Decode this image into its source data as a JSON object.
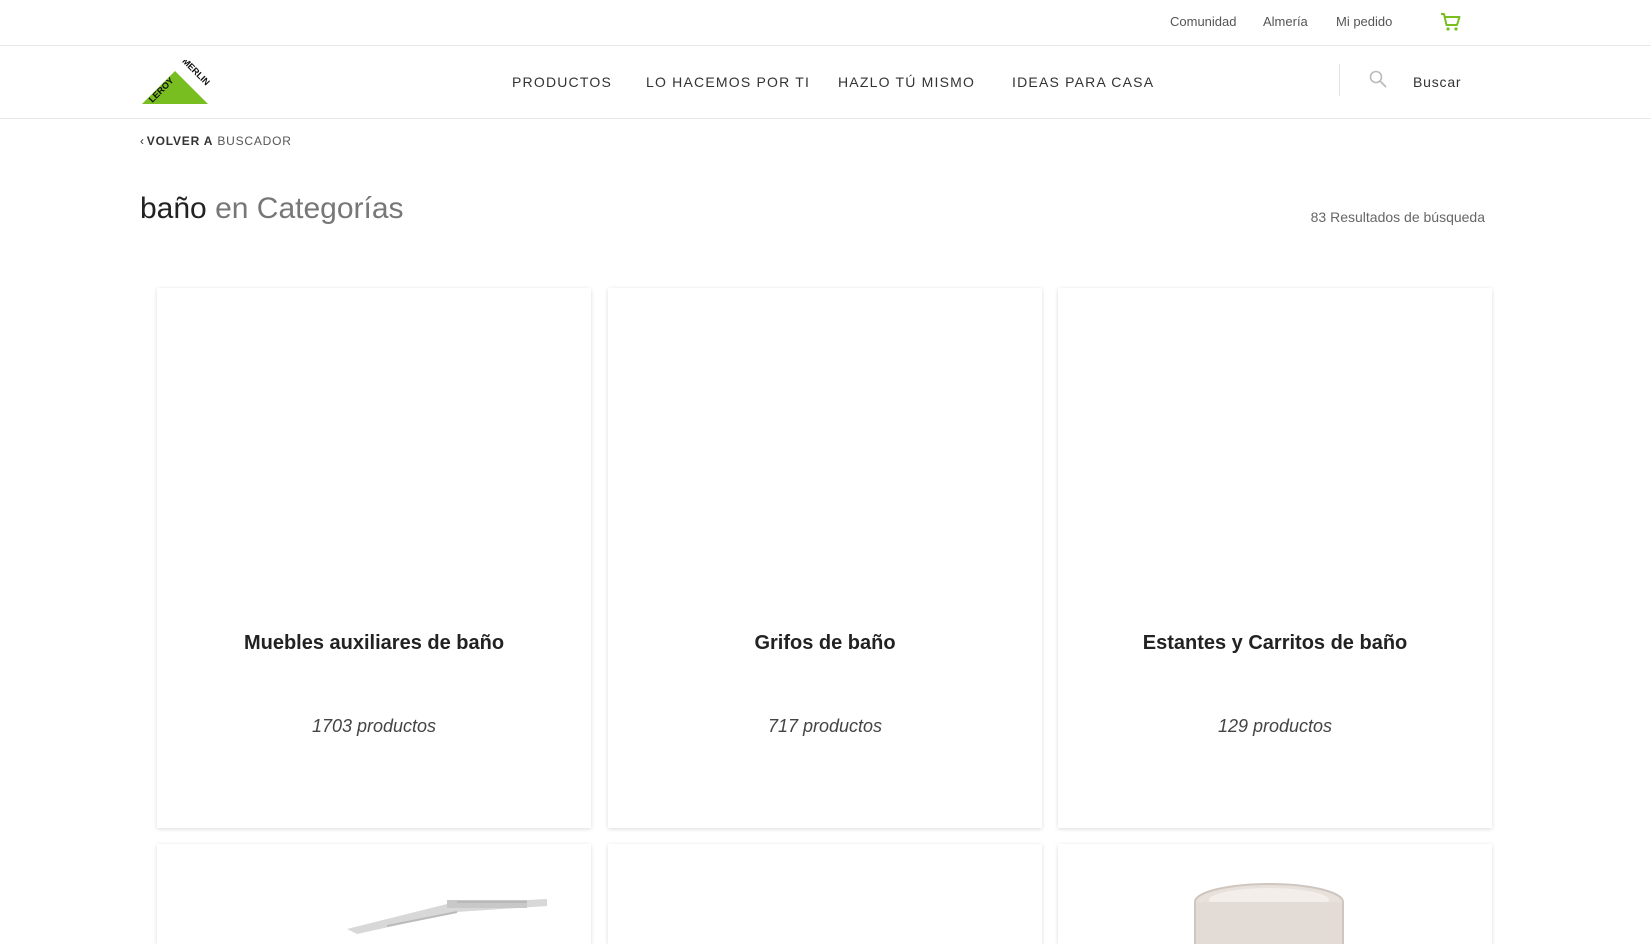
{
  "topbar": {
    "links": [
      "Comunidad",
      "Almería",
      "Mi pedido"
    ],
    "cart_icon": "shopping-cart-icon",
    "accent_color": "#78be20"
  },
  "header": {
    "logo_text": "LEROY MERLIN",
    "nav": [
      "PRODUCTOS",
      "LO HACEMOS POR TI",
      "HAZLO TÚ MISMO",
      "IDEAS PARA CASA"
    ],
    "search_icon": "search-icon",
    "search_label": "Buscar"
  },
  "back": {
    "bold": "VOLVER A",
    "light": "BUSCADOR"
  },
  "title": {
    "query": "baño",
    "scope": "en Categorías",
    "results": "83 Resultados de búsqueda"
  },
  "categories": [
    {
      "name": "Muebles auxiliares de baño",
      "count": "1703 productos"
    },
    {
      "name": "Grifos de baño",
      "count": "717 productos"
    },
    {
      "name": "Estantes y Carritos de baño",
      "count": "129 productos"
    }
  ]
}
